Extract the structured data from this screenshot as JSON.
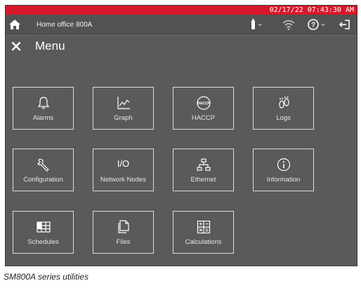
{
  "status_bar": {
    "datetime": "02/17/22 07:43:30 AM",
    "color": "#d8182a"
  },
  "top_bar": {
    "device_name": "Home office 800A",
    "icons": [
      "home-icon",
      "usb-drive-icon",
      "wifi-icon",
      "help-icon",
      "logout-icon"
    ]
  },
  "menu": {
    "title": "Menu",
    "tiles": [
      {
        "label": "Alarms",
        "icon": "bell-icon"
      },
      {
        "label": "Graph",
        "icon": "graph-icon"
      },
      {
        "label": "HACCP",
        "icon": "haccp-icon",
        "icon_text": "HACCP"
      },
      {
        "label": "Logs",
        "icon": "footprints-icon"
      },
      {
        "label": "Configuration",
        "icon": "wrench-icon"
      },
      {
        "label": "Network Nodes",
        "icon": "io-icon",
        "icon_text": "I/O"
      },
      {
        "label": "Ethernet",
        "icon": "network-icon"
      },
      {
        "label": "Information",
        "icon": "info-icon"
      },
      {
        "label": "Schedules",
        "icon": "schedule-grid-icon"
      },
      {
        "label": "Files",
        "icon": "files-icon"
      },
      {
        "label": "Calculations",
        "icon": "calculator-icon"
      }
    ]
  },
  "caption": "SM800A series utilities"
}
